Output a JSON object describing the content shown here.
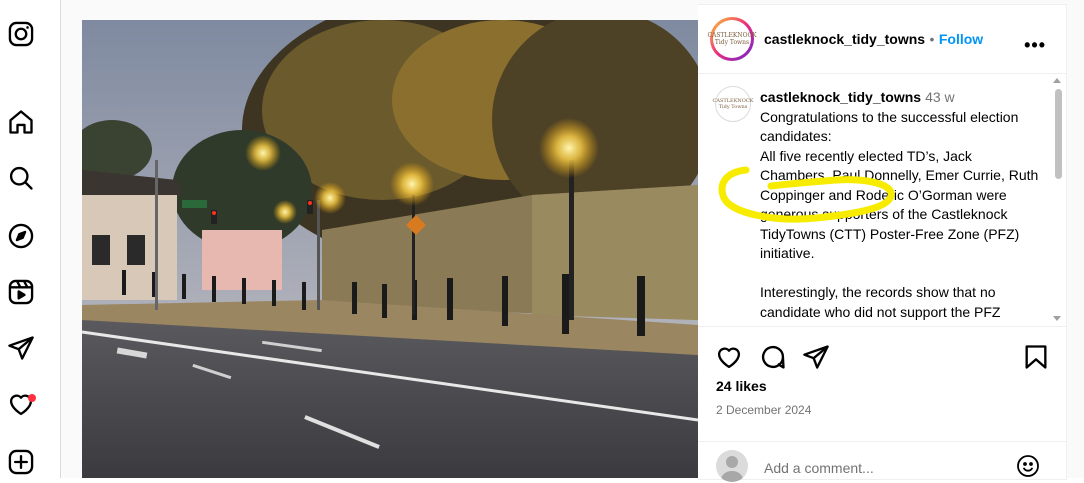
{
  "nav": {
    "icons": [
      "instagram-logo-icon",
      "home-icon",
      "search-icon",
      "explore-icon",
      "reels-icon",
      "messages-icon",
      "notifications-icon",
      "create-icon"
    ]
  },
  "post": {
    "header": {
      "username": "castleknock_tidy_towns",
      "separator": "•",
      "follow_label": "Follow",
      "more_label": "•••",
      "avatar_text": "CASTLEKNOCK Tidy Towns"
    },
    "caption": {
      "username": "castleknock_tidy_towns",
      "time": "43 w",
      "lines": [
        "Congratulations to the successful election candidates:",
        "All five recently elected TD’s, Jack Chambers, Paul Donnelly, Emer Currie, Ruth Coppinger and Roderic O’Gorman were generous supporters of the Castleknock TidyTowns (CTT) Poster-Free Zone (PFZ) initiative.",
        "",
        "Interestingly, the records show that no candidate who did not support the PFZ"
      ]
    },
    "likes": "24 likes",
    "date": "2 December 2024",
    "comment_placeholder": "Add a comment..."
  },
  "colors": {
    "accent": "#0095f6",
    "notification_dot": "#ff3040",
    "highlight": "#f7ec00"
  }
}
